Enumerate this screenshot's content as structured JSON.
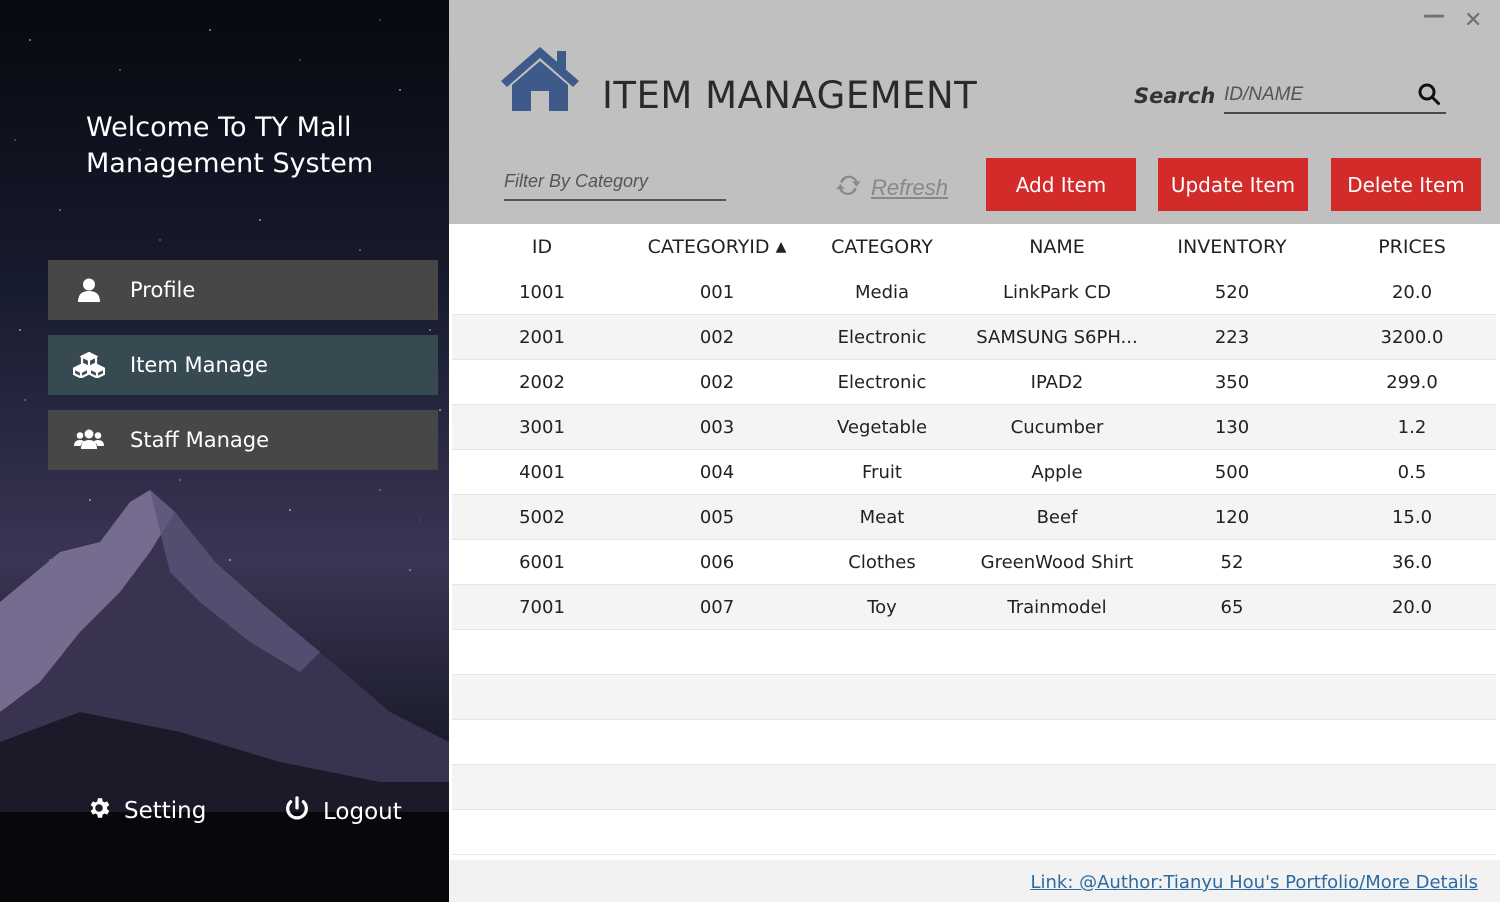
{
  "sidebar": {
    "welcome_line1": "Welcome To TY Mall",
    "welcome_line2": "Management System",
    "items": [
      {
        "label": "Profile",
        "icon": "user-icon"
      },
      {
        "label": "Item Manage",
        "icon": "cubes-icon",
        "active": true
      },
      {
        "label": "Staff Manage",
        "icon": "users-icon"
      }
    ],
    "setting_label": "Setting",
    "logout_label": "Logout"
  },
  "window": {
    "minimize": "—",
    "close": "✕"
  },
  "header": {
    "title": "ITEM MANAGEMENT",
    "search_label": "Search",
    "search_placeholder": "ID/NAME",
    "filter_placeholder": "Filter By Category",
    "refresh_label": "Refresh",
    "add_label": "Add Item",
    "update_label": "Update Item",
    "delete_label": "Delete Item"
  },
  "table": {
    "columns": [
      "ID",
      "CATEGORYID",
      "CATEGORY",
      "NAME",
      "INVENTORY",
      "PRICES"
    ],
    "sort_indicator": "▲",
    "rows": [
      [
        "1001",
        "001",
        "Media",
        "LinkPark CD",
        "520",
        "20.0"
      ],
      [
        "2001",
        "002",
        "Electronic",
        "SAMSUNG S6PH...",
        "223",
        "3200.0"
      ],
      [
        "2002",
        "002",
        "Electronic",
        "IPAD2",
        "350",
        "299.0"
      ],
      [
        "3001",
        "003",
        "Vegetable",
        "Cucumber",
        "130",
        "1.2"
      ],
      [
        "4001",
        "004",
        "Fruit",
        "Apple",
        "500",
        "0.5"
      ],
      [
        "5002",
        "005",
        "Meat",
        "Beef",
        "120",
        "15.0"
      ],
      [
        "6001",
        "006",
        "Clothes",
        "GreenWood Shirt",
        "52",
        "36.0"
      ],
      [
        "7001",
        "007",
        "Toy",
        "Trainmodel",
        "65",
        "20.0"
      ]
    ]
  },
  "footer": {
    "link_text": "Link: @Author:Tianyu Hou's Portfolio/More Details"
  },
  "colors": {
    "accent_red": "#d32a2a",
    "header_gray": "#c0c0c0",
    "home_icon_blue": "#3d5a8a",
    "nav_active": "#374a52"
  }
}
